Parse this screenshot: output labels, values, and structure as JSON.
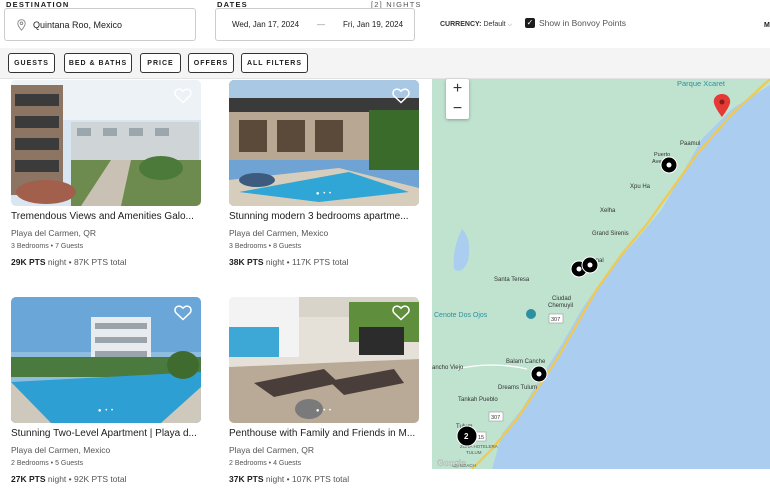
{
  "search": {
    "destination_label": "DESTINATION",
    "destination_value": "Quintana Roo, Mexico",
    "dates_label": "DATES",
    "nights_label": "[2] NIGHTS",
    "checkin": "Wed, Jan 17, 2024",
    "separator": "—",
    "checkout": "Fri, Jan 19, 2024",
    "currency_label": "CURRENCY:",
    "currency_value": "Default",
    "bonvoy_label": "Show in Bonvoy Points",
    "overflow_label": "M"
  },
  "filters": [
    "GUESTS",
    "BED & BATHS",
    "PRICE",
    "OFFERS",
    "ALL FILTERS"
  ],
  "listings": [
    {
      "title": "Tremendous Views and Amenities Galo...",
      "location": "Playa del Carmen, QR",
      "meta": "3 Bedrooms • 7 Guests",
      "price_bold": "29K PTS",
      "price_rest": " night • 87K PTS total"
    },
    {
      "title": "Stunning modern 3 bedrooms apartme...",
      "location": "Playa del Carmen, Mexico",
      "meta": "3 Bedrooms • 8 Guests",
      "price_bold": "38K PTS",
      "price_rest": " night • 117K PTS total"
    },
    {
      "title": "Stunning Two-Level Apartment | Playa d...",
      "location": "Playa del Carmen, Mexico",
      "meta": "2 Bedrooms • 5 Guests",
      "price_bold": "27K PTS",
      "price_rest": " night • 92K PTS total"
    },
    {
      "title": "Penthouse with Family and Friends in M...",
      "location": "Playa del Carmen, QR",
      "meta": "2 Bedrooms • 4 Guests",
      "price_bold": "37K PTS",
      "price_rest": " night • 107K PTS total"
    }
  ],
  "map": {
    "zoom_in": "+",
    "zoom_out": "−",
    "labels": {
      "parque_xcaret": "Parque Xcaret",
      "paamul": "Paamul",
      "puerto": "Puerto",
      "aventuras": "Aventuras",
      "xpu_ha": "Xpu Ha",
      "xelha": "Xelha",
      "grand_sirenis": "Grand Sirenis",
      "akumal": "mal",
      "santa_teresa": "Santa Teresa",
      "ciudad": "Ciudad",
      "chemuyil": "Chemuyil",
      "cenote": "Cenote Dos Ojos",
      "balam_canche": "Balam Canche",
      "rancho_viejo": "ancho Viejo",
      "dreams_tulum": "Dreams Tulum",
      "tankah_pueblo": "Tankah Pueblo",
      "tulum": "Tulum",
      "zona_hotelera": "ZONA HOTELERA",
      "tulum2": "TULUM",
      "beach": "UM BEACH",
      "cluster_count": "2",
      "route_307a": "307",
      "route_307b": "307",
      "route_15": "15",
      "google": "Google"
    },
    "colors": {
      "water": "#aacdf0",
      "land": "#bfe3cf",
      "road": "#f2c94c",
      "marker": "#000000",
      "pin": "#e53935"
    }
  }
}
